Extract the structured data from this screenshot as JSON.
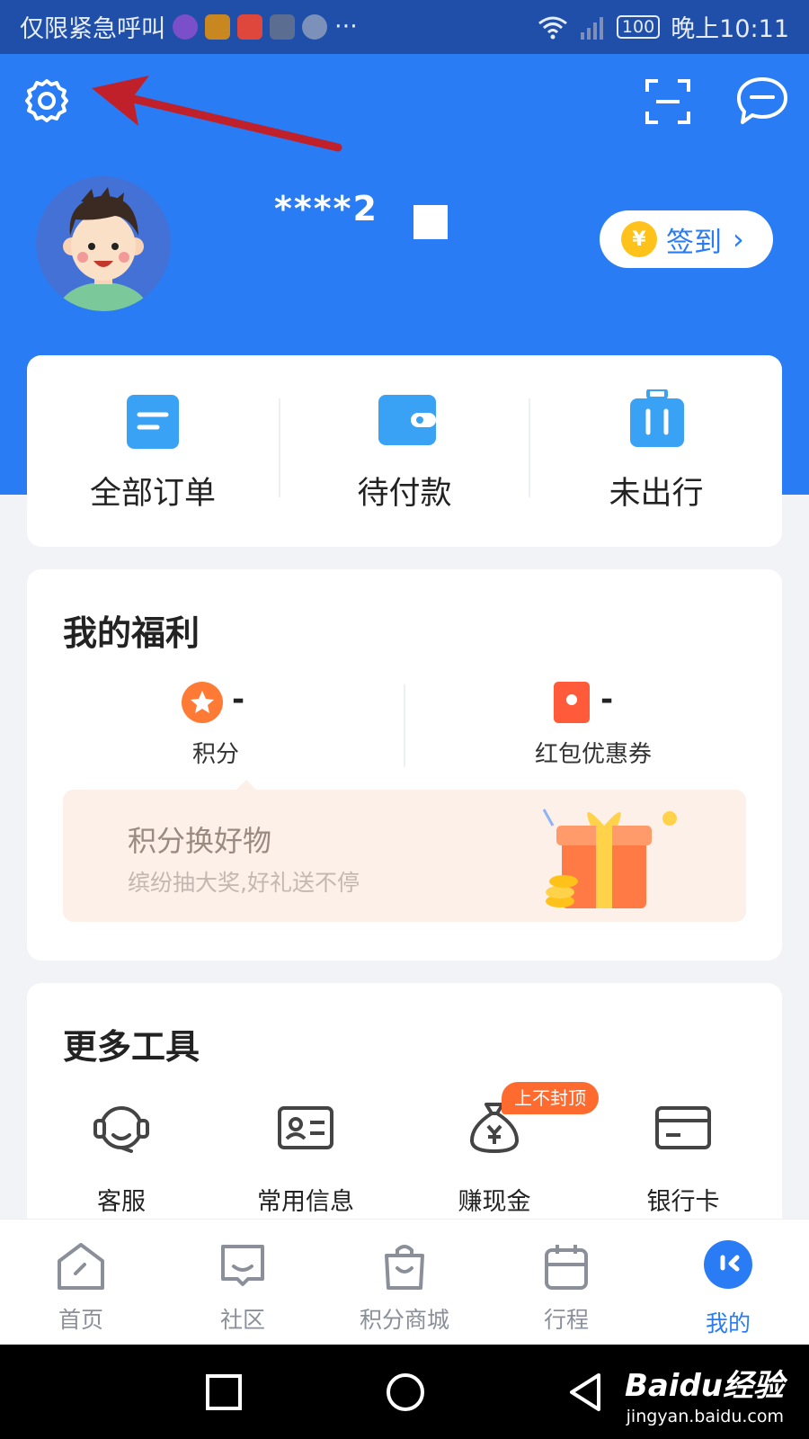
{
  "status_bar": {
    "carrier_text": "仅限紧急呼叫",
    "more": "···",
    "battery": "100",
    "time": "晚上10:11"
  },
  "header": {
    "username_masked": "****2",
    "signin_label": "签到",
    "coin_symbol": "¥"
  },
  "orders": [
    {
      "label": "全部订单",
      "icon": "order-list-icon"
    },
    {
      "label": "待付款",
      "icon": "wallet-icon"
    },
    {
      "label": "未出行",
      "icon": "luggage-icon"
    }
  ],
  "benefits": {
    "title": "我的福利",
    "points": {
      "value": "-",
      "label": "积分"
    },
    "coupons": {
      "value": "-",
      "label": "红包优惠券"
    },
    "banner": {
      "title": "积分换好物",
      "subtitle": "缤纷抽大奖,好礼送不停"
    }
  },
  "tools": {
    "title": "更多工具",
    "items": [
      {
        "label": "客服",
        "icon": "headset-icon"
      },
      {
        "label": "常用信息",
        "icon": "id-card-icon"
      },
      {
        "label": "赚现金",
        "icon": "money-bag-icon",
        "badge": "上不封顶"
      },
      {
        "label": "银行卡",
        "icon": "bank-card-icon"
      }
    ]
  },
  "tabbar": [
    {
      "label": "首页",
      "icon": "home-icon",
      "active": false
    },
    {
      "label": "社区",
      "icon": "community-icon",
      "active": false
    },
    {
      "label": "积分商城",
      "icon": "shopping-bag-icon",
      "active": false
    },
    {
      "label": "行程",
      "icon": "calendar-icon",
      "active": false
    },
    {
      "label": "我的",
      "icon": "profile-icon",
      "active": true
    }
  ],
  "watermark": {
    "brand": "Baidu经验",
    "url": "jingyan.baidu.com"
  },
  "colors": {
    "primary": "#2a7cf5",
    "accent_orange": "#ff6a2f",
    "annotation_arrow": "#c0202a"
  }
}
